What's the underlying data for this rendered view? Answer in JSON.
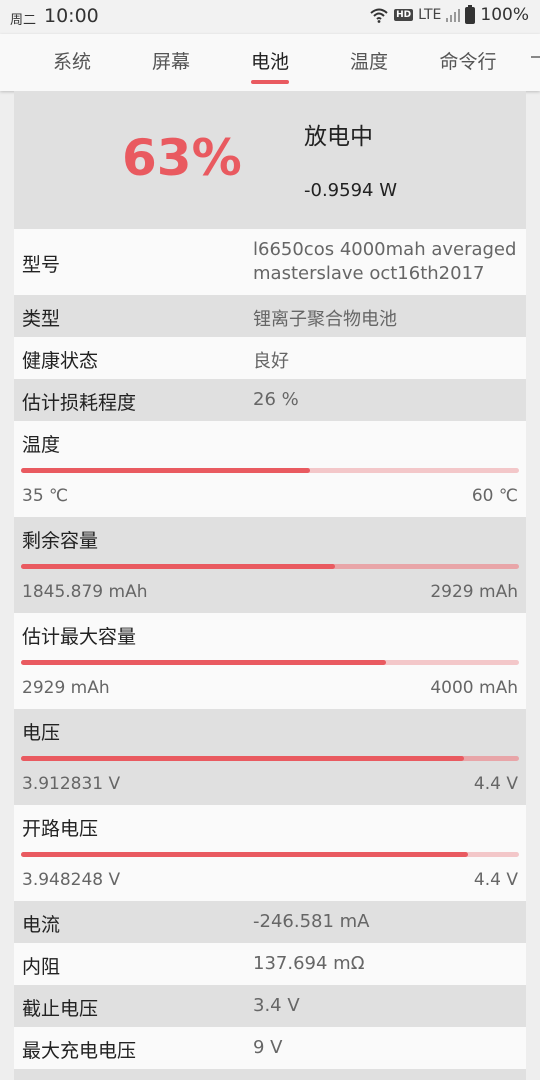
{
  "status_bar": {
    "day": "周二",
    "time": "10:00",
    "hd": "HD",
    "network": "LTE",
    "battery": "100%"
  },
  "tabs": [
    {
      "label": "系统"
    },
    {
      "label": "屏幕"
    },
    {
      "label": "电池",
      "active": true
    },
    {
      "label": "温度"
    },
    {
      "label": "命令行"
    }
  ],
  "battery": {
    "percent": "63%",
    "state": "放电中",
    "power": "-0.9594 W",
    "model_label": "型号",
    "model_value": "l6650cos 4000mah averaged masterslave oct16th2017",
    "type_label": "类型",
    "type_value": "锂离子聚合物电池",
    "health_label": "健康状态",
    "health_value": "良好",
    "wear_label": "估计损耗程度",
    "wear_value": "26 %"
  },
  "bars": {
    "temperature": {
      "label": "温度",
      "min": "35 ℃",
      "max": "60 ℃",
      "fraction": 0.58
    },
    "remaining_capacity": {
      "label": "剩余容量",
      "min": "1845.879 mAh",
      "max": "2929 mAh",
      "fraction": 0.63
    },
    "estimated_max_capacity": {
      "label": "估计最大容量",
      "min": "2929 mAh",
      "max": "4000 mAh",
      "fraction": 0.732
    },
    "voltage": {
      "label": "电压",
      "min": "3.912831 V",
      "max": "4.4 V",
      "fraction": 0.889
    },
    "open_circuit_voltage": {
      "label": "开路电压",
      "min": "3.948248 V",
      "max": "4.4 V",
      "fraction": 0.897
    }
  },
  "details": {
    "current_label": "电流",
    "current_value": "-246.581 mA",
    "resistance_label": "内阻",
    "resistance_value": "137.694 mΩ",
    "cutoff_label": "截止电压",
    "cutoff_value": "3.4 V",
    "max_charge_label": "最大充电电压",
    "max_charge_value": "9 V"
  },
  "colors": {
    "accent": "#e95a60",
    "track_light": "#f3c7c9",
    "track_dark": "#e8a5a8",
    "row_gray": "#e0e0e0",
    "row_white": "#fafafa"
  }
}
